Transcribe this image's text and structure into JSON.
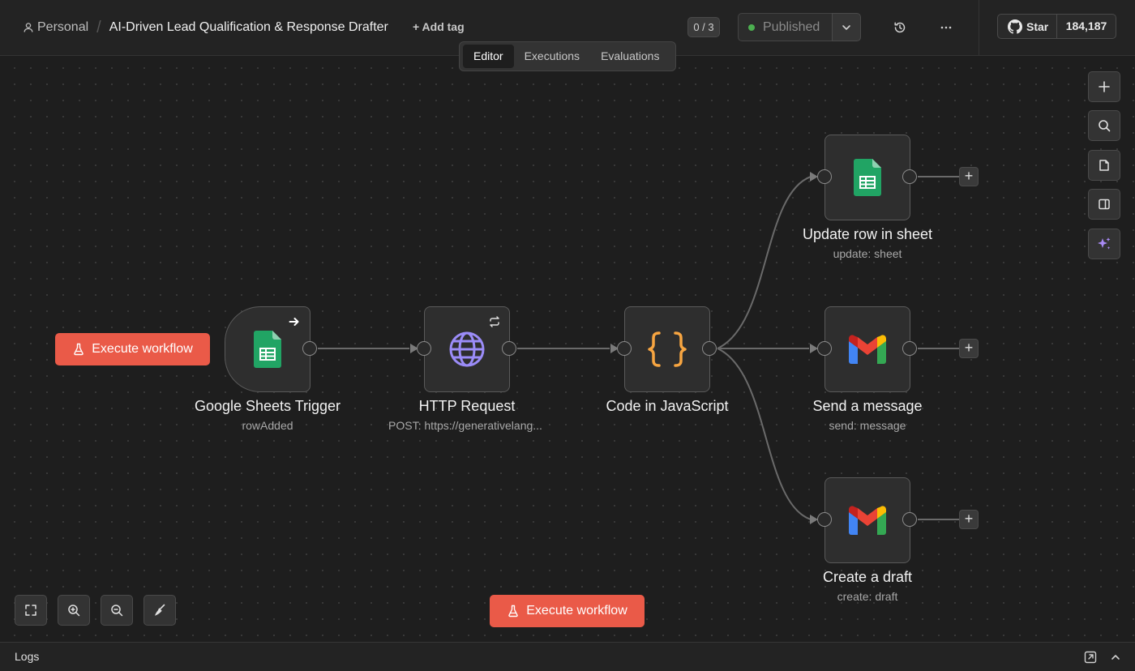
{
  "header": {
    "workspace": "Personal",
    "separator": "/",
    "workflow_title": "AI-Driven Lead Qualification & Response Drafter",
    "add_tag_label": "+ Add tag",
    "counter": "0 / 3",
    "status_label": "Published",
    "status_color": "#4caf50",
    "github_star_label": "Star",
    "github_star_count": "184,187"
  },
  "tabs": [
    {
      "label": "Editor",
      "active": true
    },
    {
      "label": "Executions",
      "active": false
    },
    {
      "label": "Evaluations",
      "active": false
    }
  ],
  "nodes": {
    "trigger": {
      "title": "Google Sheets Trigger",
      "subtitle": "rowAdded",
      "icon": "google-sheets-icon"
    },
    "http": {
      "title": "HTTP Request",
      "subtitle": "POST: https://generativelang...",
      "icon": "globe-icon"
    },
    "code": {
      "title": "Code in JavaScript",
      "subtitle": "",
      "icon": "code-braces-icon"
    },
    "update": {
      "title": "Update row in sheet",
      "subtitle": "update: sheet",
      "icon": "google-sheets-icon"
    },
    "send": {
      "title": "Send a message",
      "subtitle": "send: message",
      "icon": "gmail-icon"
    },
    "draft": {
      "title": "Create a draft",
      "subtitle": "create: draft",
      "icon": "gmail-icon"
    }
  },
  "buttons": {
    "execute_left": "Execute workflow",
    "execute_bottom": "Execute workflow"
  },
  "logs": {
    "label": "Logs"
  },
  "colors": {
    "accent": "#ea5a48",
    "sheets_green": "#21a464",
    "gmail_red": "#ea4335",
    "http_purple": "#9b8cf8",
    "code_orange": "#f7a541"
  }
}
